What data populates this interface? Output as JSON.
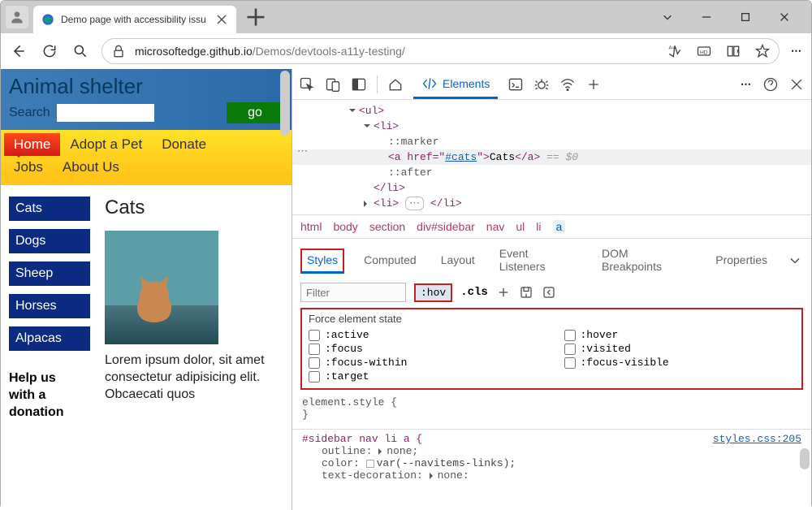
{
  "tab": {
    "title": "Demo page with accessibility issu"
  },
  "url": {
    "host": "microsoftedge.github.io",
    "path": "/Demos/devtools-a11y-testing/"
  },
  "page": {
    "title": "Animal shelter",
    "search_label": "Search",
    "go_label": "go",
    "nav": [
      "Home",
      "Adopt a Pet",
      "Donate",
      "Jobs",
      "About Us"
    ],
    "sidebar": [
      "Cats",
      "Dogs",
      "Sheep",
      "Horses",
      "Alpacas"
    ],
    "help_line1": "Help us",
    "help_line2": "with a",
    "help_line3": "donation",
    "content_heading": "Cats",
    "lorem": "Lorem ipsum dolor, sit amet consectetur adipisicing elit. Obcaecati quos"
  },
  "devtools": {
    "main_tab": "Elements",
    "elements": {
      "l_ul": "<ul>",
      "l_li": "<li>",
      "l_marker": "::marker",
      "l_a_open": "<a href=\"",
      "l_a_hrefval": "#cats",
      "l_a_openend": "\">",
      "l_a_text": "Cats",
      "l_a_close": "</a>",
      "l_eq0": " == $0",
      "l_after": "::after",
      "l_liclose": "</li>",
      "l_li2": "<li>",
      "l_li2dots": "⋯",
      "l_li2close": "</li>"
    },
    "crumbs": [
      "html",
      "body",
      "section",
      "div#sidebar",
      "nav",
      "ul",
      "li",
      "a"
    ],
    "styles_tabs": [
      "Styles",
      "Computed",
      "Layout",
      "Event Listeners",
      "DOM Breakpoints",
      "Properties"
    ],
    "filter_placeholder": "Filter",
    "hov_label": ":hov",
    "cls_label": ".cls",
    "force_title": "Force element state",
    "force_left": [
      ":active",
      ":focus",
      ":focus-within",
      ":target"
    ],
    "force_right": [
      ":hover",
      ":visited",
      ":focus-visible"
    ],
    "css_elemstyle_open": "element.style {",
    "css_elemstyle_close": "}",
    "css_rule_sel": "#sidebar nav li a {",
    "css_rule_link": "styles.css:205",
    "css_p1": "outline: ",
    "css_p1v": "none;",
    "css_p2": "color: ",
    "css_p2v": "var(--navitems-links);",
    "css_p3": "text-decoration: ",
    "css_p3v": "none:"
  }
}
